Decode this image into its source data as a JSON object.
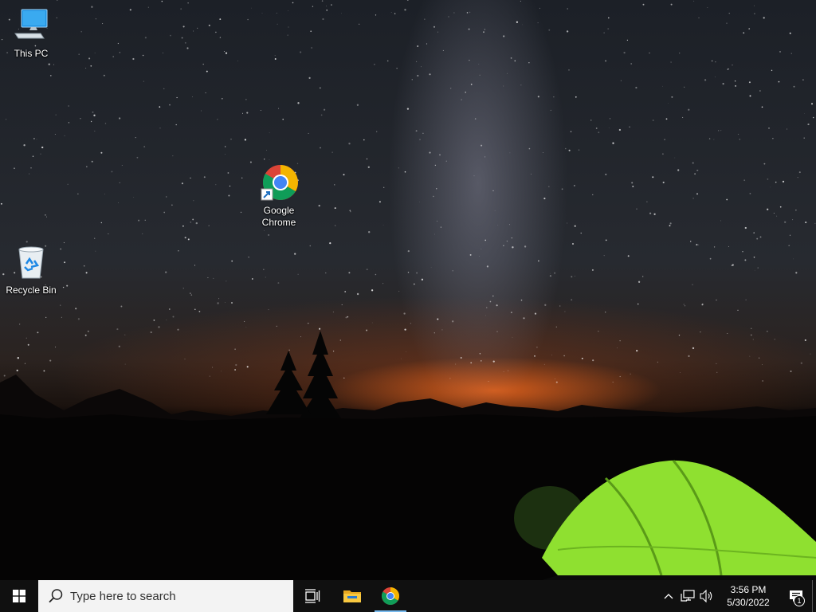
{
  "desktop": {
    "icons": [
      {
        "id": "this-pc",
        "label": "This PC"
      },
      {
        "id": "google-chrome",
        "label": "Google Chrome"
      },
      {
        "id": "recycle-bin",
        "label": "Recycle Bin"
      }
    ]
  },
  "taskbar": {
    "search": {
      "placeholder": "Type here to search"
    },
    "pinned": [
      {
        "name": "task-view",
        "icon": "task-view-icon"
      },
      {
        "name": "file-explorer",
        "icon": "folder-icon"
      },
      {
        "name": "google-chrome",
        "icon": "chrome-icon",
        "active": true
      }
    ],
    "tray": {
      "time": "3:56 PM",
      "date": "5/30/2022",
      "notification_count": "1"
    }
  },
  "colors": {
    "taskbar_bg": "#101010",
    "search_bg": "#f3f3f3",
    "active_indicator": "#76b9ed",
    "tent_green": "#8fe030"
  }
}
